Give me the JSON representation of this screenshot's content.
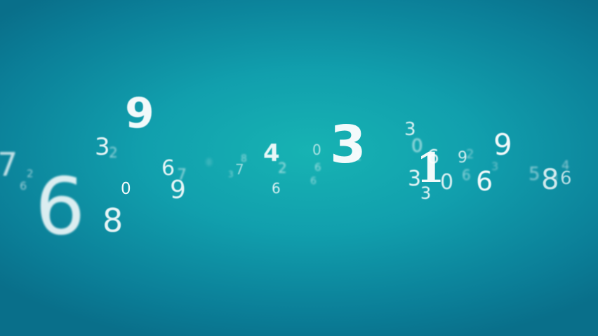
{
  "scene": {
    "background_color": "#119fad"
  },
  "digits": [
    "7",
    "2",
    "6",
    "6",
    "3",
    "2",
    "9",
    "8",
    "0",
    "6",
    "7",
    "9",
    "0",
    "8",
    "7",
    "3",
    "4",
    "2",
    "6",
    "6",
    "6",
    "0",
    "3",
    "1",
    "3",
    "0",
    "6",
    "3",
    "0",
    "1",
    "3",
    "9",
    "2",
    "6",
    "6",
    "3",
    "9",
    "5",
    "8",
    "4",
    "8",
    "6"
  ]
}
